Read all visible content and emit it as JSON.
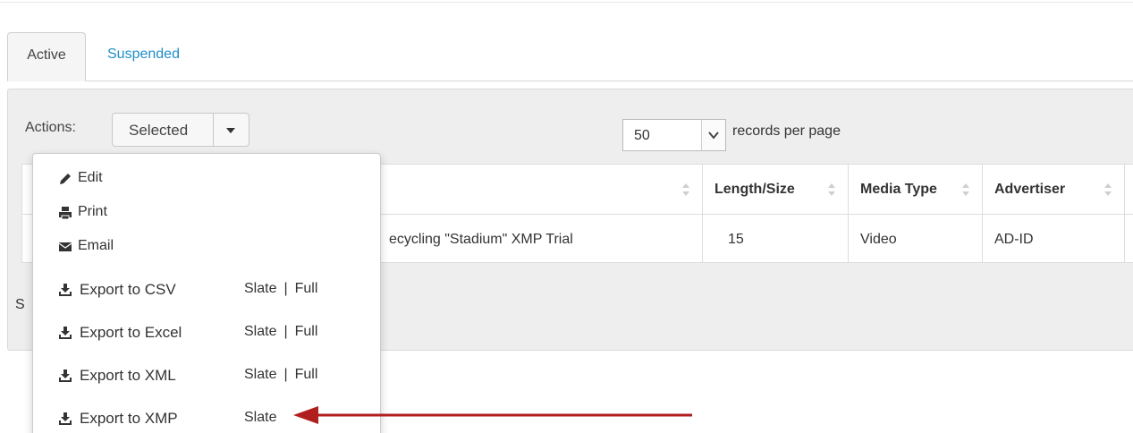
{
  "tabs": [
    {
      "label": "Active"
    },
    {
      "label": "Suspended"
    }
  ],
  "toolbar": {
    "actions_label": "Actions:",
    "selected_label": "Selected",
    "per_page_value": "50",
    "per_page_suffix": "records per page"
  },
  "table": {
    "columns": [
      "Length/Size",
      "Media Type",
      "Advertiser"
    ],
    "rows": [
      {
        "title": "ecycling \"Stadium\" XMP Trial",
        "length": "15",
        "media_type": "Video",
        "advertiser": "AD-ID"
      }
    ]
  },
  "footer": {
    "show_text": "S"
  },
  "menu": {
    "items": [
      {
        "label": "Edit",
        "icon": "pencil-icon"
      },
      {
        "label": "Print",
        "icon": "printer-icon"
      },
      {
        "label": "Email",
        "icon": "envelope-icon"
      },
      {
        "label": "Export to CSV",
        "icon": "download-icon",
        "links": [
          "Slate",
          "Full"
        ]
      },
      {
        "label": "Export to Excel",
        "icon": "download-icon",
        "links": [
          "Slate",
          "Full"
        ]
      },
      {
        "label": "Export to XML",
        "icon": "download-icon",
        "links": [
          "Slate",
          "Full"
        ]
      },
      {
        "label": "Export to XMP",
        "icon": "download-icon",
        "links": [
          "Slate"
        ]
      }
    ],
    "link_separator": "|"
  },
  "colors": {
    "link_blue": "#1f8fc8",
    "annotation_arrow": "#b01e1e"
  }
}
